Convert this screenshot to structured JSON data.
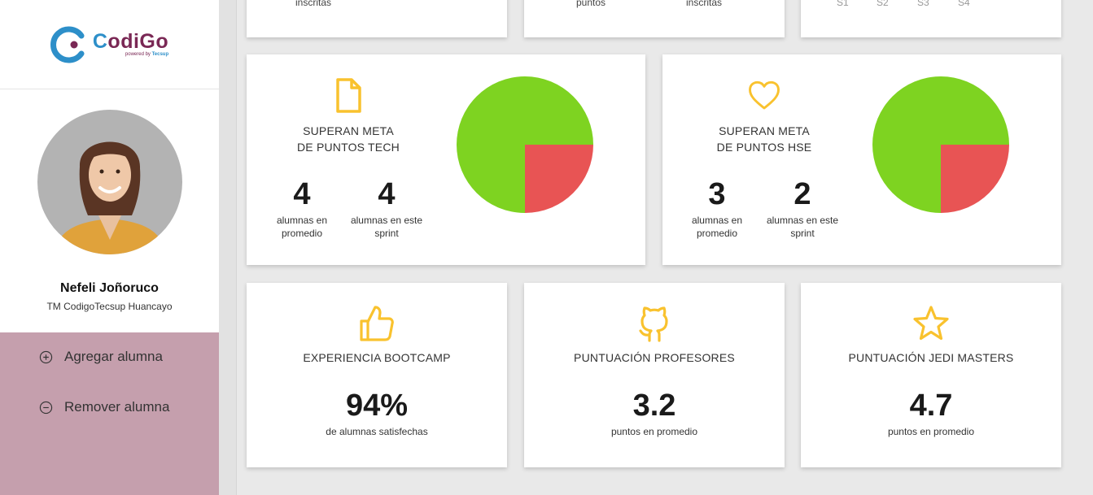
{
  "brand": {
    "word_first": "C",
    "word_rest": "odiGo",
    "tagline_prefix": "powered by ",
    "tagline_brand": "Tecsup"
  },
  "user": {
    "name": "Nefeli Joñoruco",
    "role": "TM CodigoTecsup Huancayo"
  },
  "menu": {
    "add_label": "Agregar alumna",
    "remove_label": "Remover alumna"
  },
  "top_partial": {
    "card1": {
      "label": "inscritas"
    },
    "card2": {
      "label_a": "puntos",
      "label_b": "inscritas"
    },
    "card3": {
      "ticks": [
        "S1",
        "S2",
        "S3",
        "S4"
      ]
    }
  },
  "tech": {
    "title_line1": "SUPERAN META",
    "title_line2": "DE PUNTOS TECH",
    "avg_value": "4",
    "avg_label_1": "alumnas en",
    "avg_label_2": "promedio",
    "sprint_value": "4",
    "sprint_label_1": "alumnas en este",
    "sprint_label_2": "sprint",
    "icon": "document-icon"
  },
  "hse": {
    "title_line1": "SUPERAN META",
    "title_line2": "DE PUNTOS HSE",
    "avg_value": "3",
    "avg_label_1": "alumnas en",
    "avg_label_2": "promedio",
    "sprint_value": "2",
    "sprint_label_1": "alumnas en este",
    "sprint_label_2": "sprint",
    "icon": "heart-icon"
  },
  "chart_data": [
    {
      "type": "pie",
      "values": [
        75,
        25
      ],
      "colors": [
        "#7ed321",
        "#e85454"
      ]
    },
    {
      "type": "pie",
      "values": [
        75,
        25
      ],
      "colors": [
        "#7ed321",
        "#e85454"
      ]
    }
  ],
  "bootcamp": {
    "title": "EXPERIENCIA BOOTCAMP",
    "value": "94%",
    "sub": "de alumnas satisfechas",
    "icon": "thumbs-up-icon"
  },
  "profesores": {
    "title": "PUNTUACIÓN PROFESORES",
    "value": "3.2",
    "sub": "puntos en promedio",
    "icon": "github-icon"
  },
  "jedi": {
    "title": "PUNTUACIÓN JEDI MASTERS",
    "value": "4.7",
    "sub": "puntos en promedio",
    "icon": "star-icon"
  },
  "colors": {
    "accent": "#f9c22e",
    "sidebar_menu": "#c59fad",
    "pie_pass": "#7ed321",
    "pie_fail": "#e85454"
  }
}
